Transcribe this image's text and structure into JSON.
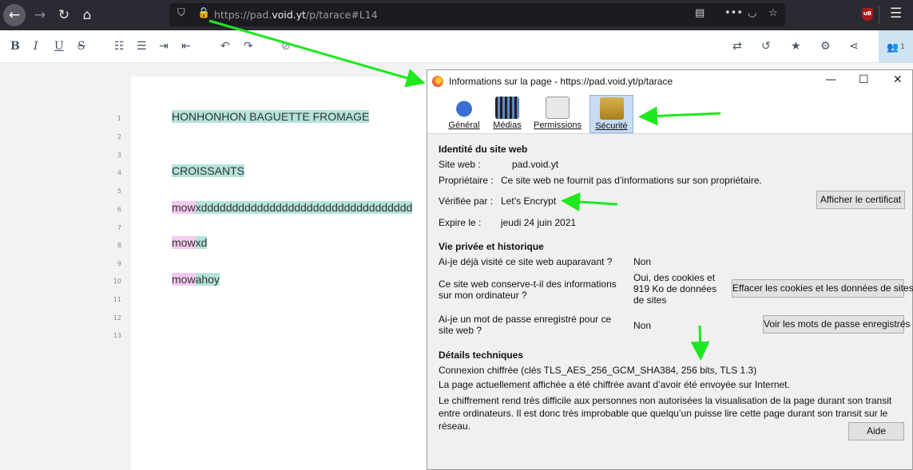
{
  "browser": {
    "url_prefix": "https://pad.",
    "url_domain": "void.yt",
    "url_path": "/p/tarace#L14",
    "ublock_badge": "uB",
    "accent": "#2b2a33"
  },
  "pad_toolbar": {
    "bold": "B",
    "italic": "I",
    "underline": "U",
    "strike": "S",
    "users_count": "1"
  },
  "editor": {
    "line_numbers": [
      "1",
      "2",
      "3",
      "4",
      "5",
      "6",
      "7",
      "8",
      "9",
      "10",
      "11",
      "12",
      "13"
    ],
    "lines": [
      {
        "segments": [
          {
            "text": "HONHONHON BAGUETTE FROMAGE",
            "hl": "teal"
          }
        ]
      },
      {
        "segments": [
          {
            "text": "CROISSANTS",
            "hl": "teal"
          }
        ]
      },
      {
        "segments": [
          {
            "text": "mow",
            "hl": "pink"
          },
          {
            "text": "xdddddddddddddddddddddddddddddddddd",
            "hl": "teal"
          }
        ]
      },
      {
        "segments": [
          {
            "text": "mow",
            "hl": "pink"
          },
          {
            "text": "xd",
            "hl": "teal"
          }
        ]
      },
      {
        "segments": [
          {
            "text": "mow",
            "hl": "pink"
          },
          {
            "text": "ahoy",
            "hl": "teal"
          }
        ]
      }
    ]
  },
  "dialog": {
    "title": "Informations sur la page - https://pad.void.yt/p/tarace",
    "tabs": [
      "Général",
      "Médias",
      "Permissions",
      "Sécurité"
    ],
    "identity": {
      "heading": "Identité du site web",
      "site_label": "Site web :",
      "site_value": "pad.void.yt",
      "owner_label": "Propriétaire :",
      "owner_value": "Ce site web ne fournit pas d’informations sur son propriétaire.",
      "verified_label": "Vérifiée par :",
      "verified_value": "Let’s Encrypt",
      "cert_button": "Afficher le certificat",
      "expires_label": "Expire le :",
      "expires_value": "jeudi 24 juin 2021"
    },
    "privacy": {
      "heading": "Vie privée et historique",
      "q1": "Ai-je déjà visité ce site web auparavant ?",
      "a1": "Non",
      "q2": "Ce site web conserve-t-il des informations sur mon ordinateur ?",
      "a2": "Oui, des cookies et 919 Ko de données de sites",
      "clear_button": "Effacer les cookies et les données de sites",
      "q3": "Ai-je un mot de passe enregistré pour ce site web ?",
      "a3": "Non",
      "passwords_button": "Voir les mots de passe enregistrés"
    },
    "technical": {
      "heading": "Détails techniques",
      "line1": "Connexion chiffrée (clés TLS_AES_256_GCM_SHA384, 256 bits, TLS 1.3)",
      "line2": "La page actuellement affichée a été chiffrée avant d’avoir été envoyée sur Internet.",
      "line3": "Le chiffrement rend très difficile aux personnes non autorisées la visualisation de la page durant son transit entre ordinateurs. Il est donc très improbable que quelqu’un puisse lire cette page durant son transit sur le réseau."
    },
    "help_button": "Aide"
  }
}
